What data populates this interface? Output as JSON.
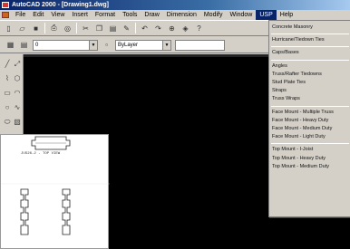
{
  "window": {
    "title": "AutoCAD 2000 - [Drawing1.dwg]"
  },
  "menubar": {
    "items": [
      "File",
      "Edit",
      "View",
      "Insert",
      "Format",
      "Tools",
      "Draw",
      "Dimension",
      "Modify",
      "Window",
      "USP",
      "Help"
    ],
    "active": "USP"
  },
  "toolbar2": {
    "layer_value": "0",
    "linetype_value": "ByLayer"
  },
  "usp_menu": {
    "group1": [
      "Concrete Masonry"
    ],
    "group2": [
      "Hurricane/Tiedown Ties"
    ],
    "group3": [
      "Caps/Bases"
    ],
    "group4": [
      "Angles",
      "Truss/Rafter Tiedowns",
      "Stud Plate Ties",
      "Straps",
      "Truss Wraps"
    ],
    "group5": [
      "Face Mount - Multiple Truss",
      "Face Mount - Heavy Duty",
      "Face Mount - Medium Duty",
      "Face Mount - Light Duty"
    ],
    "group6": [
      "Top Mount - I-Joist",
      "Top Mount - Heavy Duty",
      "Top Mount - Medium Duty"
    ]
  },
  "drawing": {
    "caption": "JUS26-2 - TOP VIEW"
  },
  "colors": {
    "titlebar": "#0a246a",
    "canvas": "#000000",
    "menu_bg": "#d4d0c8"
  }
}
